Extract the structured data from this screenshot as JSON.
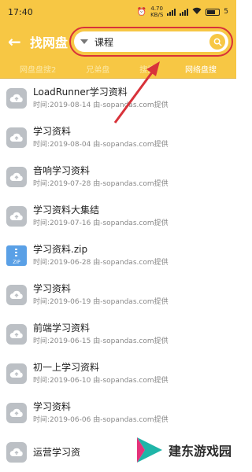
{
  "status": {
    "time": "17:40",
    "speed_value": "4.70",
    "speed_unit": "KB/S",
    "battery": "5"
  },
  "header": {
    "title": "找网盘",
    "search_query": "课程"
  },
  "tabs": [
    {
      "label": "网盘盘搜2",
      "active": false
    },
    {
      "label": "兄弟盘",
      "active": false
    },
    {
      "label": "搜搜",
      "active": false
    },
    {
      "label": "网络盘搜",
      "active": true
    }
  ],
  "files": [
    {
      "name": "LoadRunner学习资料",
      "date": "时间:2019-08-14",
      "source": "由-sopandas.com提供",
      "icon": "cloud-icon"
    },
    {
      "name": "学习资料",
      "date": "时间:2019-08-04",
      "source": "由-sopandas.com提供",
      "icon": "cloud-icon"
    },
    {
      "name": "音响学习资料",
      "date": "时间:2019-07-28",
      "source": "由-sopandas.com提供",
      "icon": "cloud-icon"
    },
    {
      "name": "学习资料大集结",
      "date": "时间:2019-07-16",
      "source": "由-sopandas.com提供",
      "icon": "cloud-icon"
    },
    {
      "name": "学习资料.zip",
      "date": "时间:2019-06-28",
      "source": "由-sopandas.com提供",
      "icon": "zip-file-icon"
    },
    {
      "name": "学习资料",
      "date": "时间:2019-06-19",
      "source": "由-sopandas.com提供",
      "icon": "cloud-icon"
    },
    {
      "name": "前端学习资料",
      "date": "时间:2019-06-15",
      "source": "由-sopandas.com提供",
      "icon": "cloud-icon"
    },
    {
      "name": "初一上学习资料",
      "date": "时间:2019-06-10",
      "source": "由-sopandas.com提供",
      "icon": "cloud-icon"
    },
    {
      "name": "学习资料",
      "date": "时间:2019-06-06",
      "source": "由-sopandas.com提供",
      "icon": "cloud-icon"
    },
    {
      "name": "运营学习资",
      "date": "",
      "source": "",
      "icon": "cloud-icon"
    }
  ],
  "zip_badge": "ZIP",
  "watermark": "建东游戏园",
  "colors": {
    "header": "#f7c744",
    "annotation": "#d8323a",
    "zip": "#5aa0e6"
  }
}
